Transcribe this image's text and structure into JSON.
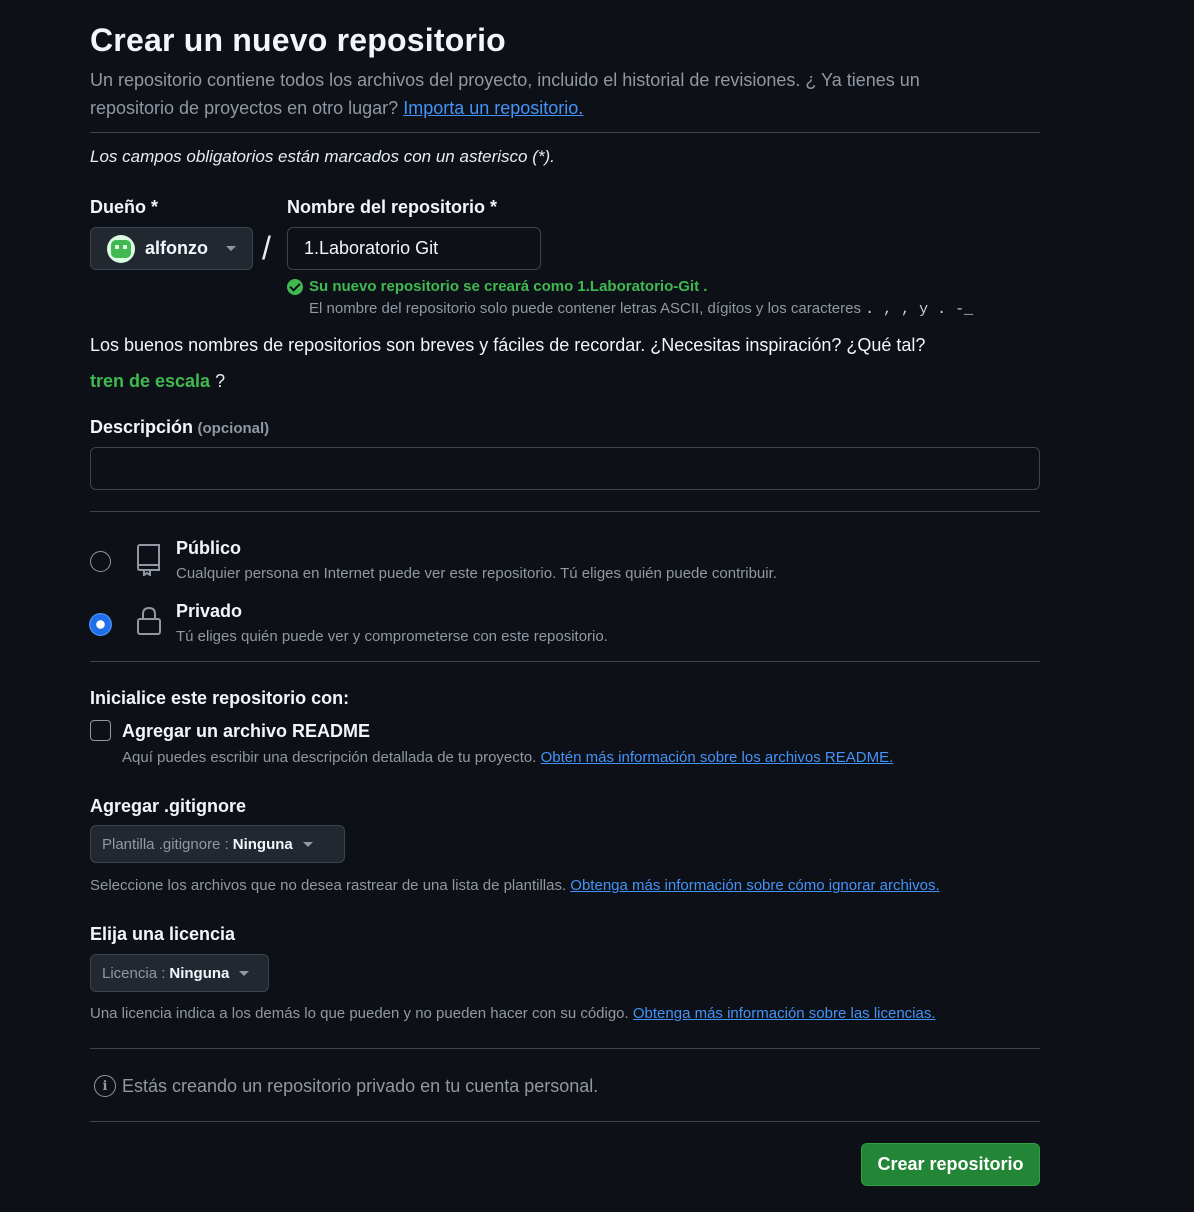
{
  "header": {
    "title": "Crear un nuevo repositorio",
    "subtitle": "Un repositorio contiene todos los archivos del proyecto, incluido el historial de revisiones. ¿ Ya tienes un repositorio de proyectos en otro lugar?",
    "import_link": "Importa un repositorio."
  },
  "required_note": "Los campos obligatorios están marcados con un asterisco (*).",
  "owner": {
    "label": "Dueño *",
    "value": "alfonzo"
  },
  "separator": "/",
  "repo_name": {
    "label": "Nombre del repositorio *",
    "value": "1.Laboratorio Git",
    "success": "Su nuevo repositorio se creará como 1.Laboratorio-Git .",
    "ascii_hint": "El nombre del repositorio solo puede contener letras ASCII, dígitos y los caracteres",
    "ascii_chars": ". , , y . -_"
  },
  "suggestion": {
    "text": "Los buenos nombres de repositorios son breves y fáciles de recordar. ¿Necesitas inspiración? ¿Qué tal?",
    "name": "tren de escala",
    "suffix": "?"
  },
  "description": {
    "label": "Descripción",
    "optional": "(opcional)",
    "value": ""
  },
  "visibility": {
    "public": {
      "title": "Público",
      "desc": "Cualquier persona en Internet puede ver este repositorio. Tú eliges quién puede contribuir.",
      "icon": "repo-icon",
      "selected": false
    },
    "private": {
      "title": "Privado",
      "desc": "Tú eliges quién puede ver y comprometerse con este repositorio.",
      "icon": "lock-icon",
      "selected": true
    }
  },
  "init": {
    "heading": "Inicialice este repositorio con:",
    "readme_label": "Agregar un archivo README",
    "readme_desc": "Aquí puedes escribir una descripción detallada de tu proyecto.",
    "readme_link": "Obtén más información sobre los archivos README.",
    "readme_checked": false
  },
  "gitignore": {
    "heading": "Agregar .gitignore",
    "prefix": "Plantilla .gitignore :",
    "value": "Ninguna",
    "desc": "Seleccione los archivos que no desea rastrear de una lista de plantillas.",
    "link": "Obtenga más información sobre cómo ignorar archivos."
  },
  "license": {
    "heading": "Elija una licencia",
    "prefix": "Licencia :",
    "value": "Ninguna",
    "desc": "Una licencia indica a los demás lo que pueden y no pueden hacer con su código.",
    "link": "Obtenga más información sobre las licencias."
  },
  "info_text": "Estás creando un repositorio privado en tu cuenta personal.",
  "submit_label": "Crear repositorio",
  "colors": {
    "background": "#0d1117",
    "accent_green": "#238636",
    "link_blue": "#4493f8",
    "success_green": "#3fb950"
  }
}
